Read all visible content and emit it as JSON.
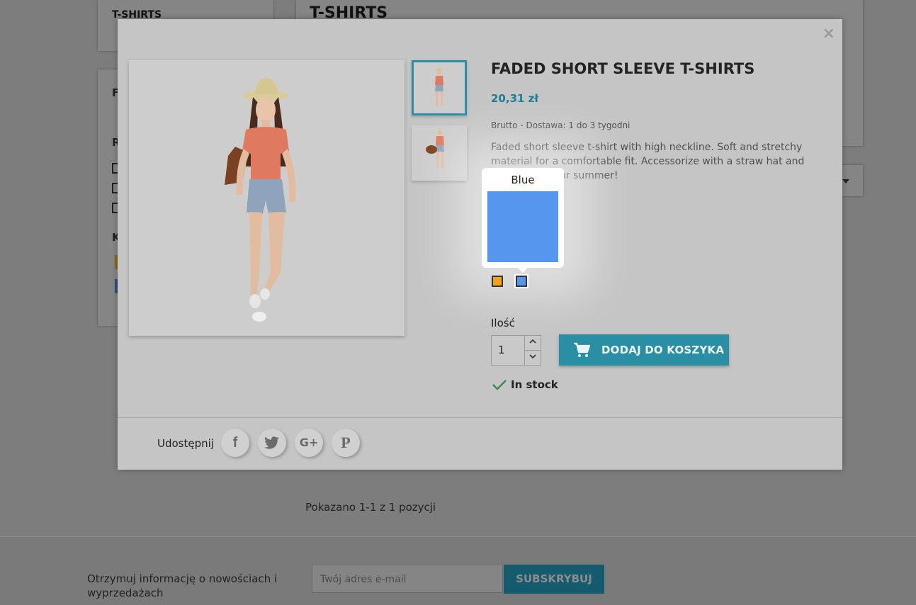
{
  "background": {
    "sidebar_category": "T-SHIRTS",
    "page_title": "T-SHIRTS",
    "filter_letters": [
      "F",
      "R",
      "K"
    ],
    "results_count": "Pokazano 1-1 z 1 pozycji",
    "newsletter_text": "Otrzymuj informację o nowościach i wyprzedażach",
    "email_placeholder": "Twój adres e-mail",
    "subscribe_label": "SUBSKRYBUJ"
  },
  "modal": {
    "close_label": "×",
    "product_title": "FADED SHORT SLEEVE T-SHIRTS",
    "price": "20,31 zł",
    "tax_info": "Brutto - Dostawa: 1 do 3 tygodni",
    "description": "Faded short sleeve t-shirt with high neckline. Soft and stretchy material for a comfortable fit. Accessorize with a straw hat and you're ready for summer!",
    "color_tooltip": "Blue",
    "colors": [
      {
        "name": "Orange",
        "hex": "#f0a316"
      },
      {
        "name": "Blue",
        "hex": "#5696ee"
      }
    ],
    "quantity_label": "Ilość",
    "quantity_value": "1",
    "add_to_cart_label": "DODAJ DO KOSZYKA",
    "stock_status": "In stock",
    "share_label": "Udostępnij",
    "social": [
      {
        "name": "facebook",
        "glyph": "f"
      },
      {
        "name": "twitter",
        "glyph": "🐦"
      },
      {
        "name": "google-plus",
        "glyph": "G+"
      },
      {
        "name": "pinterest",
        "glyph": "P"
      }
    ]
  },
  "colors": {
    "accent": "#2a8ea5",
    "price": "#1d7c95",
    "subscribe_bg": "#155b6e"
  }
}
